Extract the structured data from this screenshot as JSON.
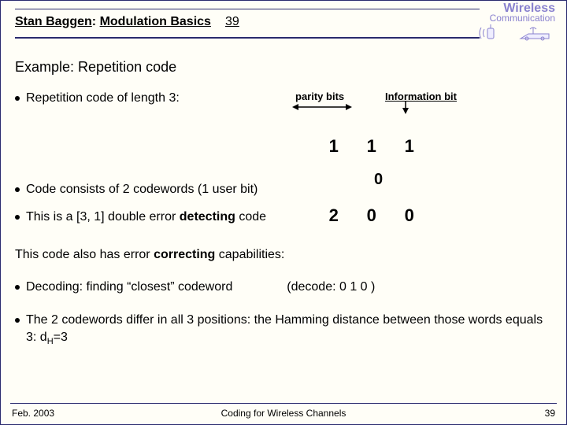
{
  "header": {
    "author": "Stan Baggen",
    "lecture": "Modulation Basics",
    "page_top": "39",
    "logo_line1": "Wireless",
    "logo_line2": "Communication"
  },
  "title": "Example: Repetition code",
  "bullets": {
    "b1": "Repetition code of length 3:",
    "b2": "Code consists of 2 codewords (1 user bit)",
    "b3_pre": "This is a [3, 1] double error ",
    "b3_bold": "detecting",
    "b3_post": " code",
    "para_pre": "This code also has error ",
    "para_bold": "correcting",
    "para_post": " capabilities:",
    "b4": "Decoding: finding “closest” codeword",
    "decode_example": "(decode:  0  1  0 )",
    "b5_pre": "The 2 codewords differ in all 3 positions: the Hamming distance between those words equals 3:  d",
    "b5_sub": "H",
    "b5_post": "=3"
  },
  "code_labels": {
    "parity": "parity bits",
    "info": "Information bit"
  },
  "codewords": {
    "row1": {
      "c1": "1",
      "c2": "1",
      "c3": "1"
    },
    "row2": {
      "c1": "2",
      "c2": "0",
      "c3": "0"
    },
    "stray": "0"
  },
  "footer": {
    "left": "Feb. 2003",
    "center": "Coding for Wireless Channels",
    "right": "39"
  }
}
